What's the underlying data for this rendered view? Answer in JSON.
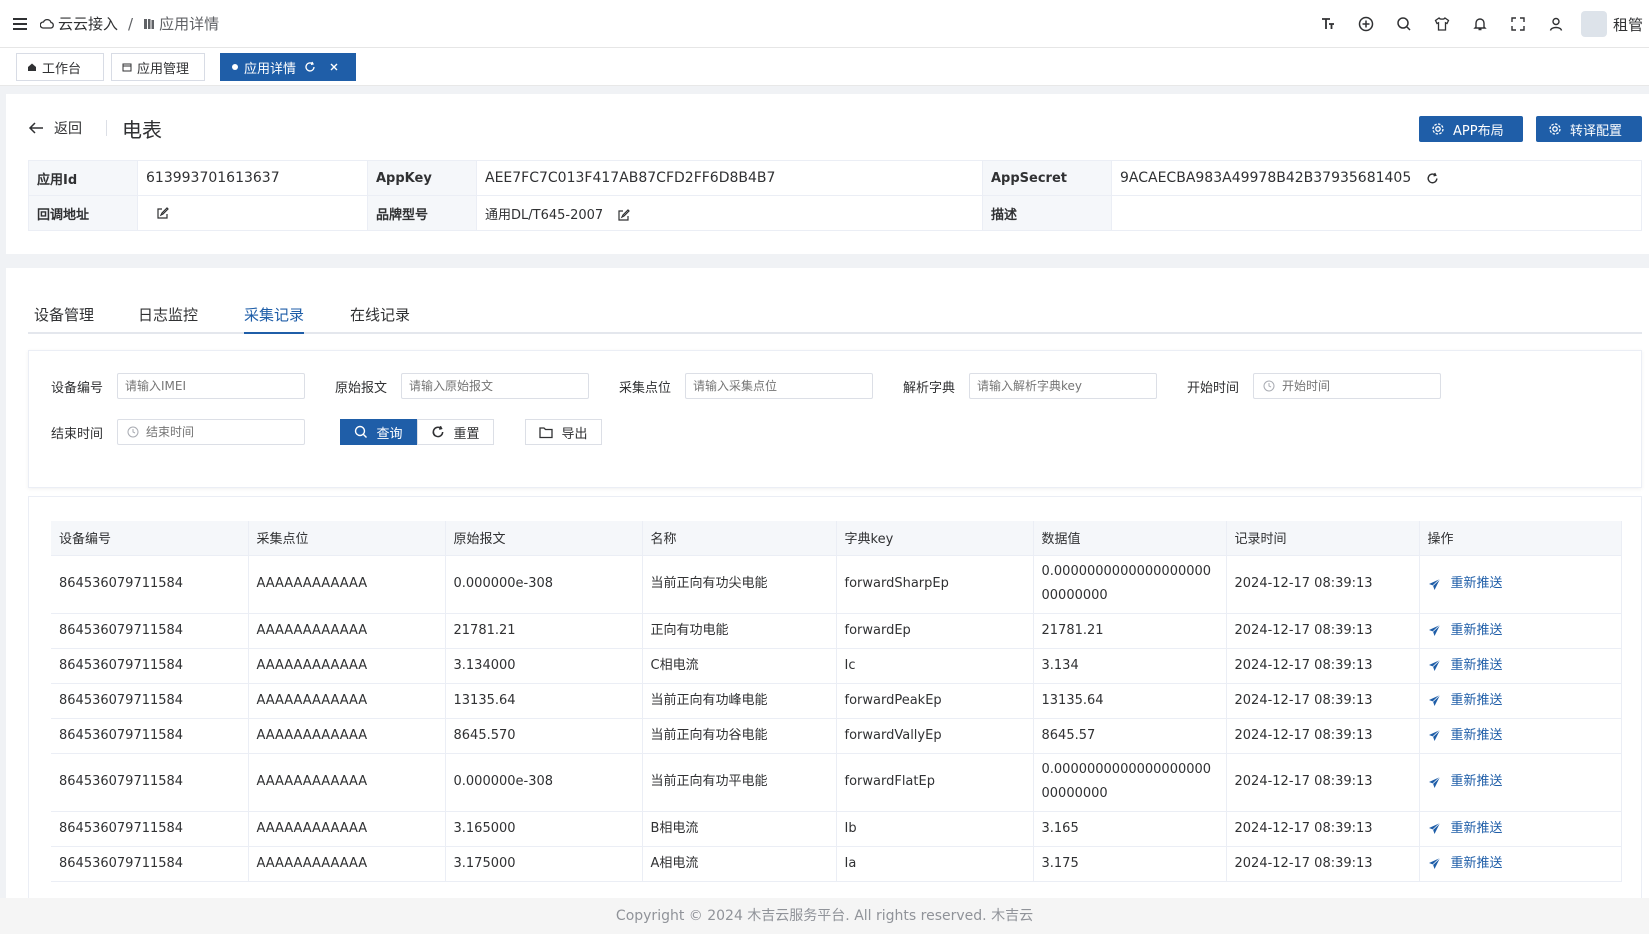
{
  "breadcrumb": {
    "root": "云云接入",
    "separator": "/",
    "current": "应用详情"
  },
  "header": {
    "user_name": "租管"
  },
  "tags": [
    {
      "label": "工作台"
    },
    {
      "label": "应用管理"
    },
    {
      "label": "应用详情"
    }
  ],
  "detail": {
    "back_label": "返回",
    "title": "电表",
    "btn_app_layout": "APP布局",
    "btn_translate": "转译配置",
    "app_id_label": "应用Id",
    "app_id": "613993701613637",
    "app_key_label": "AppKey",
    "app_key": "AEE7FC7C013F417AB87CFD2FF6D8B4B7",
    "app_secret_label": "AppSecret",
    "app_secret": "9ACAECBA983A49978B42B37935681405",
    "callback_label": "回调地址",
    "callback": "",
    "brand_label": "品牌型号",
    "brand": "通用DL/T645-2007",
    "desc_label": "描述",
    "desc": ""
  },
  "tabs": [
    {
      "label": "设备管理"
    },
    {
      "label": "日志监控"
    },
    {
      "label": "采集记录"
    },
    {
      "label": "在线记录"
    }
  ],
  "filters": {
    "device_label": "设备编号",
    "device_placeholder": "请输入IMEI",
    "raw_label": "原始报文",
    "raw_placeholder": "请输入原始报文",
    "point_label": "采集点位",
    "point_placeholder": "请输入采集点位",
    "dict_label": "解析字典",
    "dict_placeholder": "请输入解析字典key",
    "start_label": "开始时间",
    "start_placeholder": "开始时间",
    "end_label": "结束时间",
    "end_placeholder": "结束时间",
    "search_btn": "查询",
    "reset_btn": "重置",
    "export_btn": "导出"
  },
  "table": {
    "columns": [
      "设备编号",
      "采集点位",
      "原始报文",
      "名称",
      "字典key",
      "数据值",
      "记录时间",
      "操作"
    ],
    "action_label": "重新推送",
    "rows": [
      [
        "864536079711584",
        "AAAAAAAAAAAA",
        "0.000000e-308",
        "当前正向有功尖电能",
        "forwardSharpEp",
        "0.000000000000000000000000000",
        "2024-12-17 08:39:13"
      ],
      [
        "864536079711584",
        "AAAAAAAAAAAA",
        "21781.21",
        "正向有功电能",
        "forwardEp",
        "21781.21",
        "2024-12-17 08:39:13"
      ],
      [
        "864536079711584",
        "AAAAAAAAAAAA",
        "3.134000",
        "C相电流",
        "Ic",
        "3.134",
        "2024-12-17 08:39:13"
      ],
      [
        "864536079711584",
        "AAAAAAAAAAAA",
        "13135.64",
        "当前正向有功峰电能",
        "forwardPeakEp",
        "13135.64",
        "2024-12-17 08:39:13"
      ],
      [
        "864536079711584",
        "AAAAAAAAAAAA",
        "8645.570",
        "当前正向有功谷电能",
        "forwardVallyEp",
        "8645.57",
        "2024-12-17 08:39:13"
      ],
      [
        "864536079711584",
        "AAAAAAAAAAAA",
        "0.000000e-308",
        "当前正向有功平电能",
        "forwardFlatEp",
        "0.000000000000000000000000000",
        "2024-12-17 08:39:13"
      ],
      [
        "864536079711584",
        "AAAAAAAAAAAA",
        "3.165000",
        "B相电流",
        "Ib",
        "3.165",
        "2024-12-17 08:39:13"
      ],
      [
        "864536079711584",
        "AAAAAAAAAAAA",
        "3.175000",
        "A相电流",
        "Ia",
        "3.175",
        "2024-12-17 08:39:13"
      ]
    ]
  },
  "footer": {
    "text": "Copyright © 2024 木吉云服务平台. All rights reserved. 木吉云"
  }
}
